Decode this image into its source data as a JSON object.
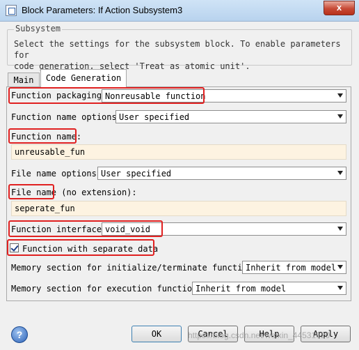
{
  "window": {
    "title": "Block Parameters: If Action Subsystem3",
    "close_glyph": "x"
  },
  "group": {
    "legend": "Subsystem",
    "description_line1": "Select the settings for the subsystem block. To enable parameters for",
    "description_line2": "code generation, select 'Treat as atomic unit'."
  },
  "tabs": [
    {
      "label": "Main"
    },
    {
      "label": "Code Generation"
    }
  ],
  "fields": {
    "function_packaging": {
      "label": "Function packaging:",
      "value": "Nonreusable function"
    },
    "function_name_options": {
      "label": "Function name options:",
      "value": "User specified"
    },
    "function_name": {
      "label": "Function name:",
      "value": "unreusable_fun"
    },
    "file_name_options": {
      "label": "File name options:",
      "value": "User specified"
    },
    "file_name": {
      "label": "File name",
      "label_suffix": " (no extension):",
      "value": "seperate_fun"
    },
    "function_interface": {
      "label": "Function interface:",
      "value": "void_void"
    },
    "separate_data": {
      "label": "Function with separate data",
      "checked": true
    },
    "memory_init_term": {
      "label": "Memory section for initialize/terminate functions:",
      "value": "Inherit from model"
    },
    "memory_exec": {
      "label": "Memory section for execution functions:",
      "value": "Inherit from model"
    }
  },
  "buttons": {
    "ok": "OK",
    "cancel": "Cancel",
    "help": "Help",
    "apply": "Apply",
    "help_glyph": "?"
  },
  "watermark": "https://blog.csdn.net/weixin_44531620",
  "colors": {
    "highlight": "#e02020",
    "input_bg": "#fdf3e1"
  }
}
